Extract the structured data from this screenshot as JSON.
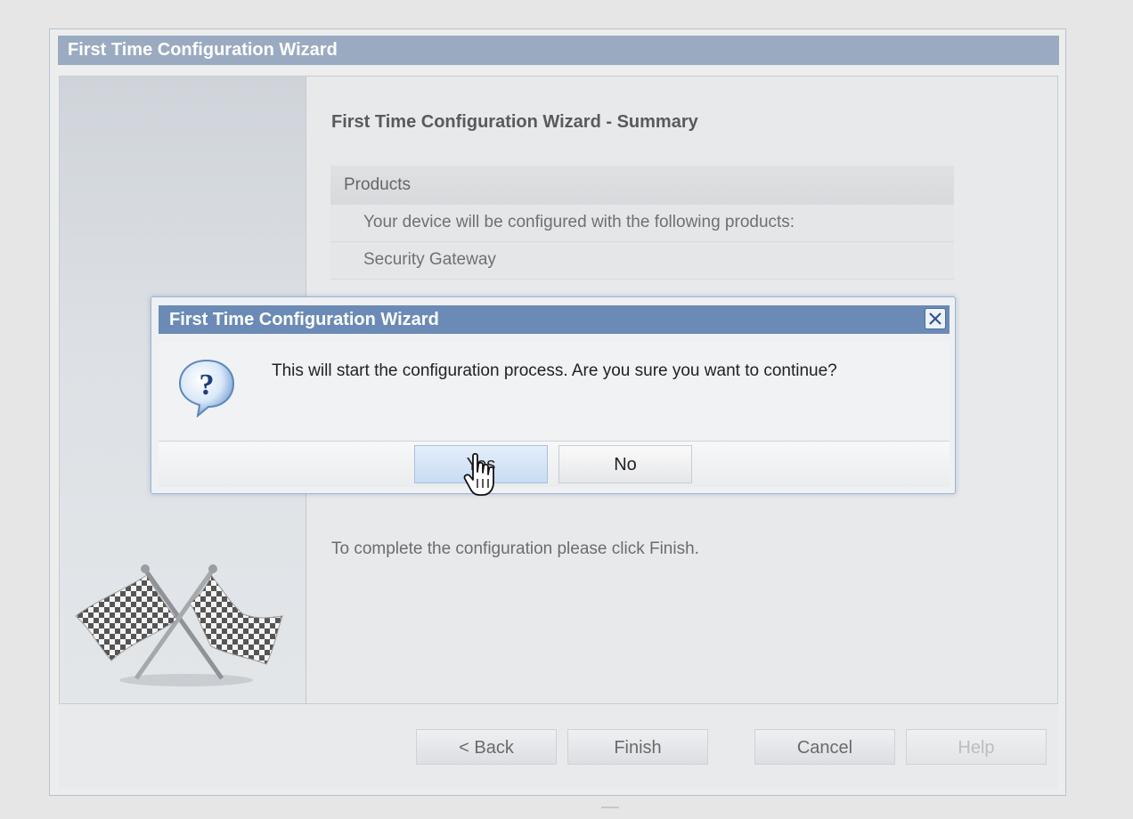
{
  "wizard": {
    "title": "First Time Configuration Wizard",
    "summary_title": "First Time Configuration Wizard - Summary",
    "products_header": "Products",
    "products_rows": [
      "Your device will be configured with the following products:",
      "Security Gateway"
    ],
    "finish_text": "To complete the configuration please click Finish.",
    "buttons": {
      "back": "< Back",
      "finish": "Finish",
      "cancel": "Cancel",
      "help": "Help"
    }
  },
  "dialog": {
    "title": "First Time Configuration Wizard",
    "message": "This will start the configuration process. Are you sure you want to continue?",
    "yes_label": "Yes",
    "no_label": "No",
    "icon": "question-icon"
  },
  "colors": {
    "wizard_titlebar": "#9aaac1",
    "dialog_titlebar": "#6b8bb6",
    "yes_button": "#c9dcf3"
  }
}
